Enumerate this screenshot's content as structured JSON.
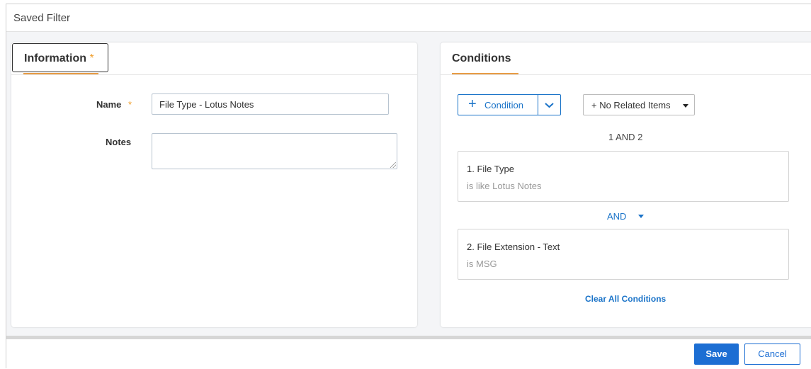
{
  "window": {
    "title": "Saved Filter"
  },
  "information": {
    "tab_label": "Information",
    "required_marker": "*",
    "name_label": "Name",
    "name_required_marker": "*",
    "name_value": "File Type - Lotus Notes",
    "notes_label": "Notes",
    "notes_value": ""
  },
  "conditions": {
    "tab_label": "Conditions",
    "add_condition_label": "Condition",
    "related_items_label": "+ No Related Items",
    "logic_expression": "1 AND 2",
    "items": [
      {
        "title": "1. File Type",
        "detail": "is like Lotus Notes"
      },
      {
        "title": "2. File Extension - Text",
        "detail": "is MSG"
      }
    ],
    "operator": "AND",
    "clear_all_label": "Clear All Conditions"
  },
  "footer": {
    "save_label": "Save",
    "cancel_label": "Cancel"
  },
  "colors": {
    "accent": "#1a73c8",
    "tab_underline": "#e89c45",
    "required": "#f0a030"
  }
}
